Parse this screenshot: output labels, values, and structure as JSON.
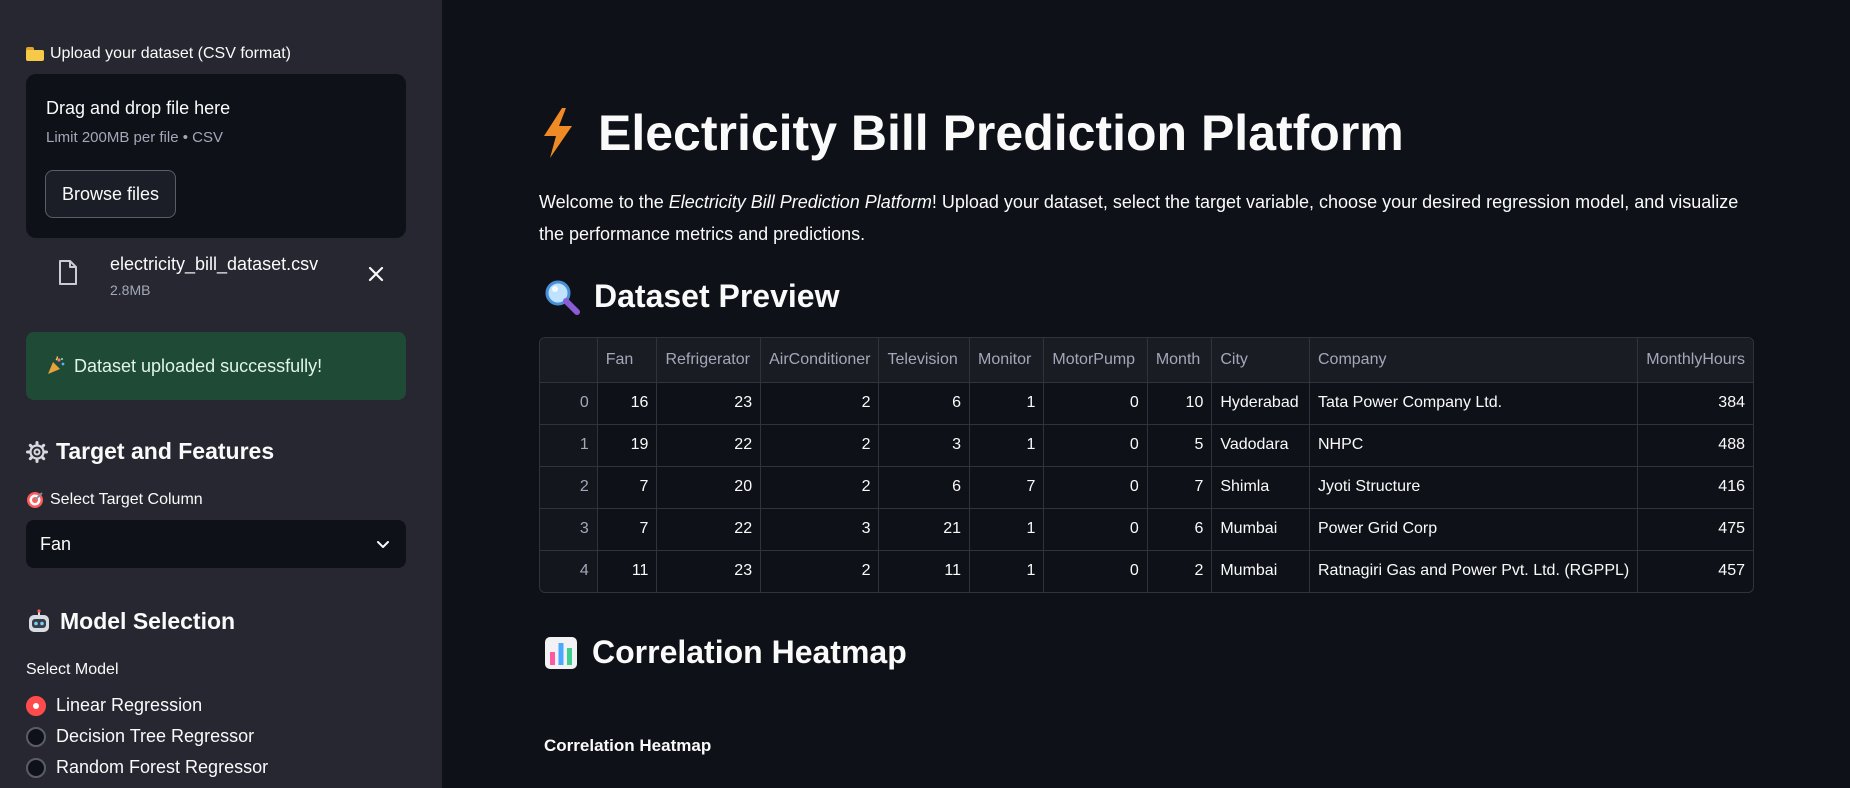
{
  "sidebar": {
    "upload_label": "Upload your dataset (CSV format)",
    "dropzone_title": "Drag and drop file here",
    "dropzone_sub": "Limit 200MB per file • CSV",
    "browse_label": "Browse files",
    "file_name": "electricity_bill_dataset.csv",
    "file_size": "2.8MB",
    "success_message": "Dataset uploaded successfully!",
    "target_header": "Target and Features",
    "target_label": "Select Target Column",
    "target_value": "Fan",
    "model_header": "Model Selection",
    "model_label": "Select Model",
    "models": [
      {
        "label": "Linear Regression",
        "checked": true
      },
      {
        "label": "Decision Tree Regressor",
        "checked": false
      },
      {
        "label": "Random Forest Regressor",
        "checked": false
      }
    ]
  },
  "main": {
    "title": "Electricity Bill Prediction Platform",
    "intro_prefix": "Welcome to the ",
    "intro_em": "Electricity Bill Prediction Platform",
    "intro_suffix": "! Upload your dataset, select the target variable, choose your desired regression model, and visualize the performance metrics and predictions.",
    "preview_header": "Dataset Preview",
    "heatmap_header": "Correlation Heatmap",
    "heatmap_subheader": "Correlation Heatmap",
    "table": {
      "columns": [
        "",
        "Fan",
        "Refrigerator",
        "AirConditioner",
        "Television",
        "Monitor",
        "MotorPump",
        "Month",
        "City",
        "Company",
        "MonthlyHours"
      ],
      "rows": [
        [
          "0",
          "16",
          "23",
          "2",
          "6",
          "1",
          "0",
          "10",
          "Hyderabad",
          "Tata Power Company Ltd.",
          "384"
        ],
        [
          "1",
          "19",
          "22",
          "2",
          "3",
          "1",
          "0",
          "5",
          "Vadodara",
          "NHPC",
          "488"
        ],
        [
          "2",
          "7",
          "20",
          "2",
          "6",
          "7",
          "0",
          "7",
          "Shimla",
          "Jyoti Structure",
          "416"
        ],
        [
          "3",
          "7",
          "22",
          "3",
          "21",
          "1",
          "0",
          "6",
          "Mumbai",
          "Power Grid Corp",
          "475"
        ],
        [
          "4",
          "11",
          "23",
          "2",
          "11",
          "1",
          "0",
          "2",
          "Mumbai",
          "Ratnagiri Gas and Power Pvt. Ltd. (RGPPL)",
          "457"
        ]
      ]
    }
  },
  "colors": {
    "accent": "#ff4b4b",
    "success_bg": "#1f4a35",
    "sidebar_bg": "#262730",
    "main_bg": "#0e1117"
  }
}
